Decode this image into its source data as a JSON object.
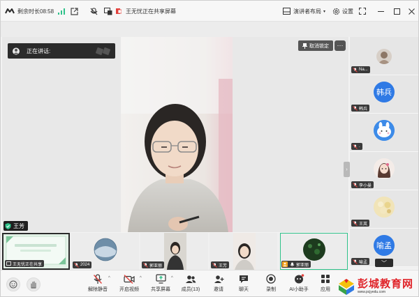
{
  "titlebar": {
    "remaining_time": "剩余时长08:58",
    "share_status": "王无忧正在共享屏幕",
    "layout_label": "演讲者布局",
    "settings_label": "设置"
  },
  "stage": {
    "speaking_label": "正在讲话:",
    "unlock_label": "取消锁定",
    "more_label": "···",
    "presenter_name": "王芳"
  },
  "participants": [
    {
      "name": "Na..."
    },
    {
      "name": "韩兵",
      "avatar_text": "韩兵"
    },
    {
      "name": "."
    },
    {
      "name": "李小曼"
    },
    {
      "name": "王岚"
    },
    {
      "name": "喻孟",
      "avatar_text": "喻孟"
    }
  ],
  "strip": [
    {
      "name": "王无忧正在共享"
    },
    {
      "name": "2024"
    },
    {
      "name": "郭亚丽"
    },
    {
      "name": "王芳"
    },
    {
      "name": "郭亚丽"
    }
  ],
  "toolbar": {
    "unmute": "解除静音",
    "start_video": "开启视频",
    "share_screen": "共享屏幕",
    "members": "成员(13)",
    "invite": "邀请",
    "chat": "聊天",
    "record": "录制",
    "ai_assistant": "AI小助手",
    "apps": "应用"
  },
  "watermark": {
    "text": "彭城教育网",
    "url": "www.pcjyedu.com"
  },
  "colors": {
    "accent_blue": "#2f7ae5",
    "mute_red": "#e2413c",
    "active_green": "#2fc28a"
  }
}
